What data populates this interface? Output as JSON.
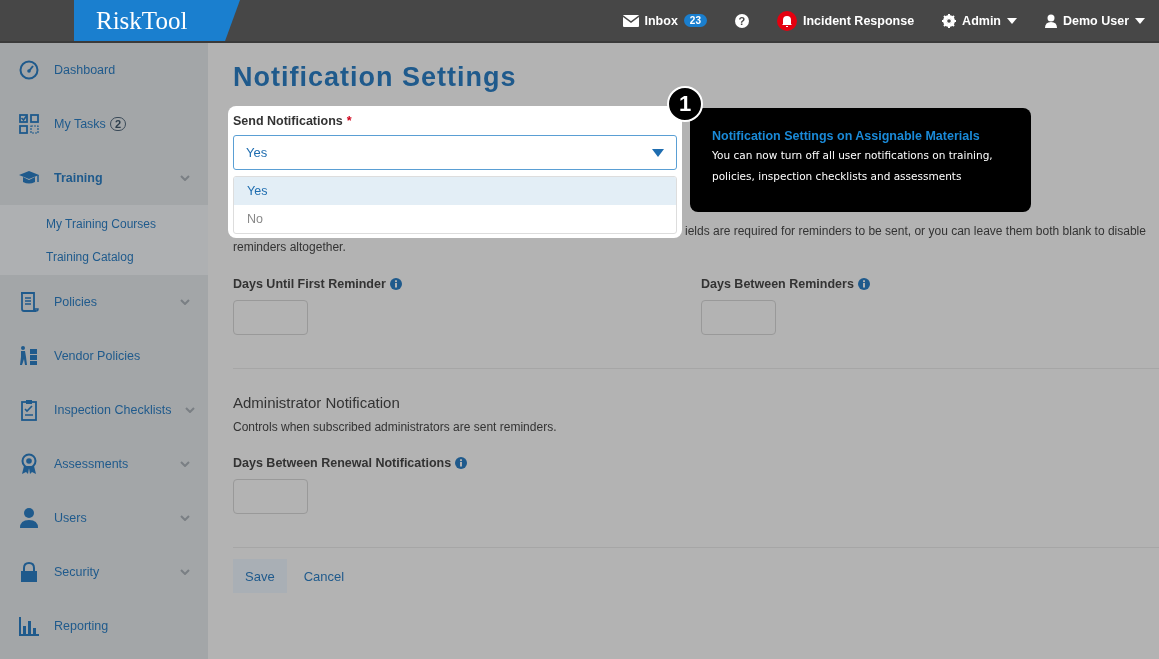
{
  "header": {
    "logo": "RiskTool",
    "inbox": {
      "label": "Inbox",
      "count": "23"
    },
    "help": "?",
    "incident": "Incident Response",
    "admin": "Admin",
    "user": "Demo User"
  },
  "sidebar": {
    "items": [
      {
        "label": "Dashboard",
        "expandable": false,
        "selected": false
      },
      {
        "label": "My Tasks",
        "badge": "2",
        "expandable": false,
        "selected": false
      },
      {
        "label": "Training",
        "expandable": true,
        "selected": true,
        "children": [
          {
            "label": "My Training Courses"
          },
          {
            "label": "Training Catalog"
          }
        ]
      },
      {
        "label": "Policies",
        "expandable": true,
        "selected": false
      },
      {
        "label": "Vendor Policies",
        "expandable": false,
        "selected": false
      },
      {
        "label": "Inspection Checklists",
        "expandable": true,
        "selected": false
      },
      {
        "label": "Assessments",
        "expandable": true,
        "selected": false
      },
      {
        "label": "Users",
        "expandable": true,
        "selected": false
      },
      {
        "label": "Security",
        "expandable": true,
        "selected": false
      },
      {
        "label": "Reporting",
        "expandable": false,
        "selected": false
      }
    ]
  },
  "page": {
    "title": "Notification Settings"
  },
  "send_notifications": {
    "label": "Send Notifications",
    "required_mark": "*",
    "value": "Yes",
    "options": [
      {
        "label": "Yes",
        "selected": true
      },
      {
        "label": "No",
        "selected": false
      }
    ]
  },
  "step_badge": "1",
  "tooltip": {
    "title": "Notification Settings on Assignable Materials",
    "body": "You can now turn off all user notifications on  training, policies, inspection checklists and assessments"
  },
  "reminder_note": {
    "line_1": "ields are required for reminders to be sent, or you can leave them both blank to disable",
    "line_2": "reminders altogether."
  },
  "reminder_fields": [
    {
      "label": "Days Until First Reminder",
      "info": true
    },
    {
      "label": "Days Between Reminders",
      "info": true
    }
  ],
  "admin": {
    "heading": "Administrator Notification",
    "description": "Controls when subscribed administrators are sent reminders.",
    "field": {
      "label": "Days Between Renewal Notifications",
      "info": true
    }
  },
  "actions": {
    "save": "Save",
    "cancel": "Cancel"
  }
}
